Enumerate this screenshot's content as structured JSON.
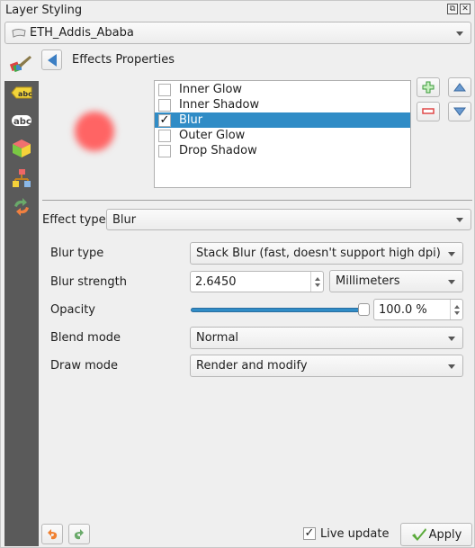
{
  "window": {
    "title": "Layer Styling",
    "float_icon": "float-icon",
    "close_icon": "close-icon"
  },
  "layer_selector": {
    "value": "ETH_Addis_Ababa",
    "icon": "polygon-layer-icon"
  },
  "sidebar": {
    "items": [
      {
        "name": "labels-icon",
        "label": "abc"
      },
      {
        "name": "masks-icon",
        "label": "abc"
      },
      {
        "name": "3d-view-icon"
      },
      {
        "name": "diagrams-icon"
      },
      {
        "name": "history-icon"
      }
    ],
    "top_icon": "symbology-paintbrush-icon"
  },
  "header": {
    "back_icon": "back-arrow-icon",
    "title": "Effects Properties"
  },
  "effects": {
    "list": [
      {
        "label": "Inner Glow",
        "checked": false,
        "selected": false
      },
      {
        "label": "Inner Shadow",
        "checked": false,
        "selected": false
      },
      {
        "label": "Blur",
        "checked": true,
        "selected": true
      },
      {
        "label": "Outer Glow",
        "checked": false,
        "selected": false
      },
      {
        "label": "Drop Shadow",
        "checked": false,
        "selected": false
      }
    ],
    "preview_color": "#ff6464",
    "check_glyph": "✓"
  },
  "effect_type": {
    "label": "Effect type",
    "value": "Blur"
  },
  "properties": {
    "blur_type": {
      "label": "Blur type",
      "value": "Stack Blur (fast, doesn't support high dpi)"
    },
    "blur_strength": {
      "label": "Blur strength",
      "value": "2.6450",
      "unit": "Millimeters"
    },
    "opacity": {
      "label": "Opacity",
      "value": "100.0 %",
      "fraction": 1.0
    },
    "blend_mode": {
      "label": "Blend mode",
      "value": "Normal"
    },
    "draw_mode": {
      "label": "Draw mode",
      "value": "Render and modify"
    }
  },
  "footer": {
    "live_update_label": "Live update",
    "live_update_checked": true,
    "apply_label": "Apply"
  },
  "colors": {
    "accent": "#308cc6",
    "sidebar": "#5a5a5a"
  }
}
